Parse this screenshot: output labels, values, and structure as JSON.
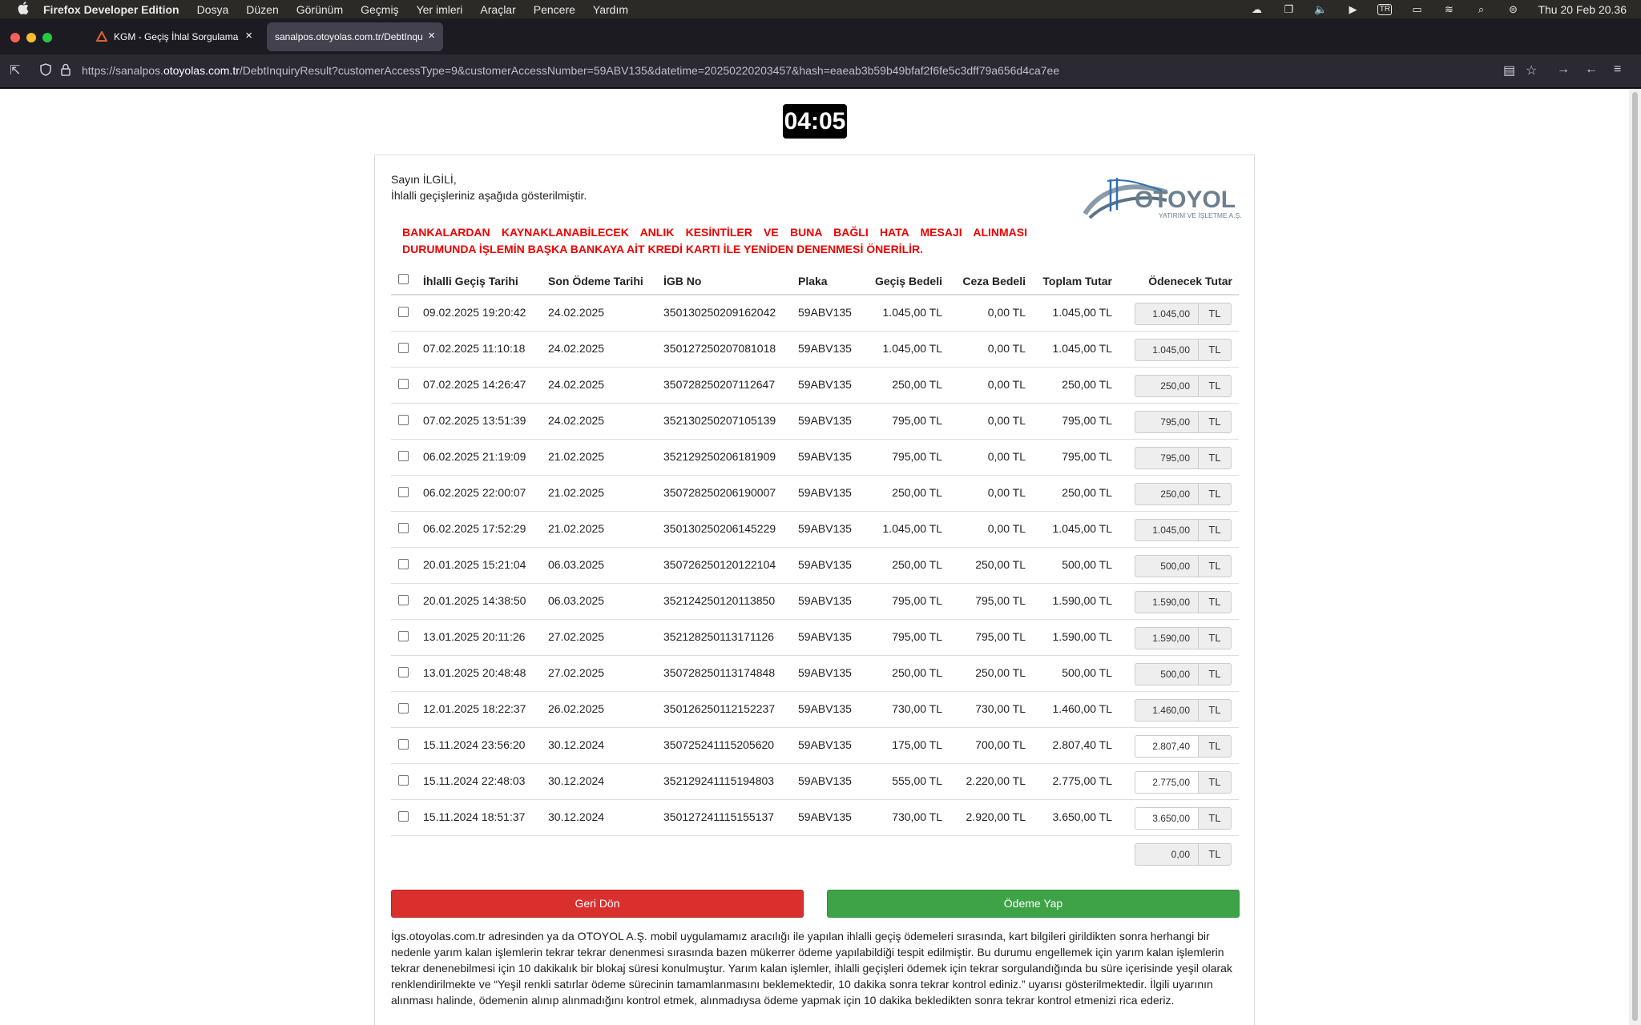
{
  "menubar": {
    "items": [
      "Firefox Developer Edition",
      "Dosya",
      "Düzen",
      "Görünüm",
      "Geçmiş",
      "Yer imleri",
      "Araçlar",
      "Pencere",
      "Yardım"
    ],
    "input_source": "TR",
    "clock": "Thu 20 Feb  20.36"
  },
  "tabs": [
    {
      "label": "KGM - Geçiş İhlal Sorgulama",
      "active": false
    },
    {
      "label": "sanalpos.otoyolas.com.tr/DebtInquiryResult",
      "active": true
    }
  ],
  "address_bar": {
    "prefix": "https://sanalpos.",
    "host": "otoyolas.com.tr",
    "path": "/DebtInquiryResult?customerAccessType=9&customerAccessNumber=59ABV135&datetime=20250220203457&hash=eaeab3b59b49bfaf2f6fe5c3dff79a656d4ca7ee"
  },
  "timer": "04:05",
  "greeting": {
    "line1": "Sayın İLGİLİ,",
    "line2": "İhlalli geçişleriniz aşağıda gösterilmiştir."
  },
  "logo": {
    "name": "OTOYOL",
    "tagline": "YATIRIM VE İŞLETME A.Ş."
  },
  "warning": "BANKALARDAN KAYNAKLANABİLECEK ANLIK KESİNTİLER VE BUNA BAĞLI HATA MESAJI ALINMASI DURUMUNDA İŞLEMİN BAŞKA BANKAYA AİT KREDİ KARTI İLE YENİDEN DENENMESİ ÖNERİLİR.",
  "table": {
    "headers": {
      "date": "İhlalli Geçiş Tarihi",
      "due": "Son Ödeme Tarihi",
      "igb": "İGB No",
      "plate": "Plaka",
      "pass": "Geçiş Bedeli",
      "fine": "Ceza Bedeli",
      "total": "Toplam Tutar",
      "pay": "Ödenecek Tutar"
    },
    "currency": "TL",
    "rows": [
      {
        "date": "09.02.2025 19:20:42",
        "due": "24.02.2025",
        "igb": "350130250209162042",
        "plate": "59ABV135",
        "pass": "1.045,00 TL",
        "fine": "0,00 TL",
        "total": "1.045,00 TL",
        "pay": "1.045,00"
      },
      {
        "date": "07.02.2025 11:10:18",
        "due": "24.02.2025",
        "igb": "350127250207081018",
        "plate": "59ABV135",
        "pass": "1.045,00 TL",
        "fine": "0,00 TL",
        "total": "1.045,00 TL",
        "pay": "1.045,00"
      },
      {
        "date": "07.02.2025 14:26:47",
        "due": "24.02.2025",
        "igb": "350728250207112647",
        "plate": "59ABV135",
        "pass": "250,00 TL",
        "fine": "0,00 TL",
        "total": "250,00 TL",
        "pay": "250,00"
      },
      {
        "date": "07.02.2025 13:51:39",
        "due": "24.02.2025",
        "igb": "352130250207105139",
        "plate": "59ABV135",
        "pass": "795,00 TL",
        "fine": "0,00 TL",
        "total": "795,00 TL",
        "pay": "795,00"
      },
      {
        "date": "06.02.2025 21:19:09",
        "due": "21.02.2025",
        "igb": "352129250206181909",
        "plate": "59ABV135",
        "pass": "795,00 TL",
        "fine": "0,00 TL",
        "total": "795,00 TL",
        "pay": "795,00"
      },
      {
        "date": "06.02.2025 22:00:07",
        "due": "21.02.2025",
        "igb": "350728250206190007",
        "plate": "59ABV135",
        "pass": "250,00 TL",
        "fine": "0,00 TL",
        "total": "250,00 TL",
        "pay": "250,00"
      },
      {
        "date": "06.02.2025 17:52:29",
        "due": "21.02.2025",
        "igb": "350130250206145229",
        "plate": "59ABV135",
        "pass": "1.045,00 TL",
        "fine": "0,00 TL",
        "total": "1.045,00 TL",
        "pay": "1.045,00"
      },
      {
        "date": "20.01.2025 15:21:04",
        "due": "06.03.2025",
        "igb": "350726250120122104",
        "plate": "59ABV135",
        "pass": "250,00 TL",
        "fine": "250,00 TL",
        "total": "500,00 TL",
        "pay": "500,00"
      },
      {
        "date": "20.01.2025 14:38:50",
        "due": "06.03.2025",
        "igb": "352124250120113850",
        "plate": "59ABV135",
        "pass": "795,00 TL",
        "fine": "795,00 TL",
        "total": "1.590,00 TL",
        "pay": "1.590,00"
      },
      {
        "date": "13.01.2025 20:11:26",
        "due": "27.02.2025",
        "igb": "352128250113171126",
        "plate": "59ABV135",
        "pass": "795,00 TL",
        "fine": "795,00 TL",
        "total": "1.590,00 TL",
        "pay": "1.590,00"
      },
      {
        "date": "13.01.2025 20:48:48",
        "due": "27.02.2025",
        "igb": "350728250113174848",
        "plate": "59ABV135",
        "pass": "250,00 TL",
        "fine": "250,00 TL",
        "total": "500,00 TL",
        "pay": "500,00"
      },
      {
        "date": "12.01.2025 18:22:37",
        "due": "26.02.2025",
        "igb": "350126250112152237",
        "plate": "59ABV135",
        "pass": "730,00 TL",
        "fine": "730,00 TL",
        "total": "1.460,00 TL",
        "pay": "1.460,00"
      },
      {
        "date": "15.11.2024 23:56:20",
        "due": "30.12.2024",
        "igb": "350725241115205620",
        "plate": "59ABV135",
        "pass": "175,00 TL",
        "fine": "700,00 TL",
        "total": "2.807,40 TL",
        "pay": "2.807,40"
      },
      {
        "date": "15.11.2024 22:48:03",
        "due": "30.12.2024",
        "igb": "352129241115194803",
        "plate": "59ABV135",
        "pass": "555,00 TL",
        "fine": "2.220,00 TL",
        "total": "2.775,00 TL",
        "pay": "2.775,00"
      },
      {
        "date": "15.11.2024 18:51:37",
        "due": "30.12.2024",
        "igb": "350127241115155137",
        "plate": "59ABV135",
        "pass": "730,00 TL",
        "fine": "2.920,00 TL",
        "total": "3.650,00 TL",
        "pay": "3.650,00"
      }
    ],
    "grand_total": "0,00"
  },
  "buttons": {
    "back": "Geri Dön",
    "pay": "Ödeme Yap"
  },
  "info_text": "İgs.otoyolas.com.tr adresinden ya da OTOYOL A.Ş. mobil uygulamamız aracılığı ile yapılan ihlalli geçiş ödemeleri sırasında, kart bilgileri girildikten sonra herhangi bir nedenle yarım kalan işlemlerin tekrar tekrar denenmesi sırasında bazen mükerrer ödeme yapılabildiği tespit edilmiştir. Bu durumu engellemek için yarım kalan işlemlerin tekrar denenebilmesi için 10 dakikalık bir blokaj süresi konulmuştur. Yarım kalan işlemler, ihlalli geçişleri ödemek için tekrar sorgulandığında bu süre içerisinde yeşil olarak renklendirilmekte ve “Yeşil renkli satırlar ödeme sürecinin tamamlanmasını beklemektedir, 10 dakika sonra tekrar kontrol ediniz.” uyarısı gösterilmektedir. İlgili uyarının alınması halinde, ödemenin alınıp alınmadığını kontrol etmek, alınmadıysa ödeme yapmak için 10 dakika bekledikten sonra tekrar kontrol etmenizi rica ederiz."
}
